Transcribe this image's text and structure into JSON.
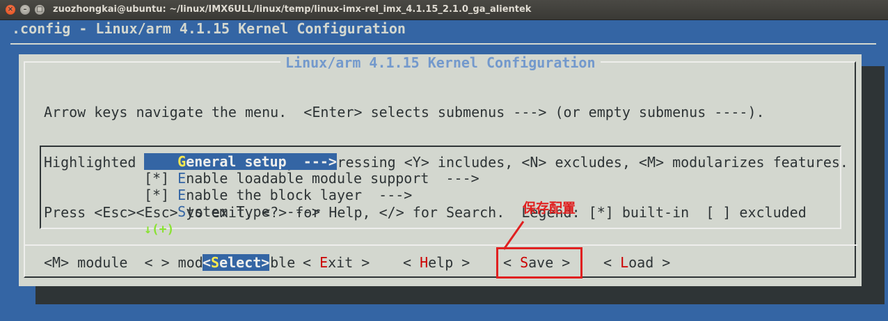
{
  "window": {
    "title": "zuozhongkai@ubuntu: ~/linux/IMX6ULL/linux/temp/linux-imx-rel_imx_4.1.15_2.1.0_ga_alientek",
    "close_glyph": "×",
    "minimize_glyph": "–",
    "maximize_glyph": "□"
  },
  "config_title": ".config - Linux/arm 4.1.15 Kernel Configuration",
  "dialog": {
    "title": "Linux/arm 4.1.15 Kernel Configuration",
    "help_lines": [
      "Arrow keys navigate the menu.  <Enter> selects submenus ---> (or empty submenus ----).",
      "Highlighted letters are hotkeys.  Pressing <Y> includes, <N> excludes, <M> modularizes features.",
      "Press <Esc><Esc> to exit, <?> for Help, </> for Search.  Legend: [*] built-in  [ ] excluded",
      "<M> module  < > module capable"
    ],
    "menu_items": [
      {
        "prefix": "    ",
        "hotkey": "G",
        "rest": "eneral setup  --->",
        "selected": true
      },
      {
        "prefix": "[*] ",
        "hotkey": "E",
        "rest": "nable loadable module support  --->",
        "selected": false
      },
      {
        "prefix": "[*] ",
        "hotkey": "E",
        "rest": "nable the block layer  --->",
        "selected": false
      },
      {
        "prefix": "    ",
        "hotkey": "S",
        "rest": "ystem Type  --->",
        "selected": false
      }
    ],
    "more_indicator": "↓(+)",
    "buttons": [
      {
        "pre": "<",
        "hotkey": "S",
        "rest": "elect>",
        "active": true
      },
      {
        "pre": "< ",
        "hotkey": "E",
        "rest": "xit >",
        "active": false
      },
      {
        "pre": "< ",
        "hotkey": "H",
        "rest": "elp >",
        "active": false
      },
      {
        "pre": "< ",
        "hotkey": "S",
        "rest": "ave >",
        "active": false
      },
      {
        "pre": "< ",
        "hotkey": "L",
        "rest": "oad >",
        "active": false
      }
    ]
  },
  "annotation": {
    "text": "保存配置",
    "color": "#e02020"
  }
}
